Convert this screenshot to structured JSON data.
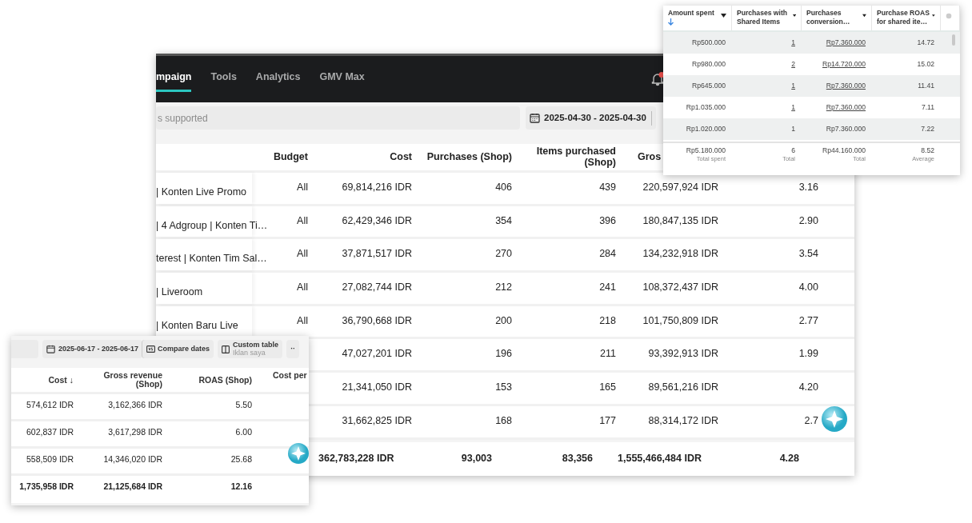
{
  "main_window": {
    "nav": {
      "tabs": [
        {
          "label": "mpaign",
          "selected": true
        },
        {
          "label": "Tools",
          "selected": false
        },
        {
          "label": "Analytics",
          "selected": false
        },
        {
          "label": "GMV Max",
          "selected": false
        }
      ],
      "has_notification": true
    },
    "search": {
      "placeholder": "s supported"
    },
    "date_range": "2025-04-30 - 2025-04-30",
    "table": {
      "headers": {
        "budget": "Budget",
        "cost": "Cost",
        "purchases": "Purchases (Shop)",
        "items": "Items purchased (Shop)",
        "gross": "Gros"
      },
      "rows": [
        {
          "name": "| Konten Live Promo",
          "budget": "All",
          "cost": "69,814,216 IDR",
          "purchases": "406",
          "items": "439",
          "gross": "220,597,924 IDR",
          "roas": "3.16"
        },
        {
          "name": "| 4 Adgroup | Konten Ti…",
          "budget": "All",
          "cost": "62,429,346 IDR",
          "purchases": "354",
          "items": "396",
          "gross": "180,847,135 IDR",
          "roas": "2.90"
        },
        {
          "name": "terest | Konten Tim Sal…",
          "budget": "All",
          "cost": "37,871,517 IDR",
          "purchases": "270",
          "items": "284",
          "gross": "134,232,918 IDR",
          "roas": "3.54"
        },
        {
          "name": "| Liveroom",
          "budget": "All",
          "cost": "27,082,744 IDR",
          "purchases": "212",
          "items": "241",
          "gross": "108,372,437 IDR",
          "roas": "4.00"
        },
        {
          "name": "| Konten Baru Live",
          "budget": "All",
          "cost": "36,790,668 IDR",
          "purchases": "200",
          "items": "218",
          "gross": "101,750,809 IDR",
          "roas": "2.77"
        },
        {
          "cost": "47,027,201 IDR",
          "purchases": "196",
          "items": "211",
          "gross": "93,392,913 IDR",
          "roas": "1.99"
        },
        {
          "cost": "21,341,050 IDR",
          "purchases": "153",
          "items": "165",
          "gross": "89,561,216 IDR",
          "roas": "4.20"
        },
        {
          "cost": "31,662,825 IDR",
          "purchases": "168",
          "items": "177",
          "gross": "88,314,172 IDR",
          "roas": "2.7"
        }
      ],
      "totals": {
        "cost": "362,783,228 IDR",
        "purchases": "93,003",
        "items": "83,356",
        "gross": "1,555,466,484 IDR",
        "roas": "4.28"
      }
    }
  },
  "shared_items_panel": {
    "columns": [
      {
        "label": "Amount spent",
        "sorted": true
      },
      {
        "label": "Purchases with Shared Items",
        "sorted": false
      },
      {
        "label": "Purchases conversion…",
        "sorted": false
      },
      {
        "label": "Purchase ROAS for shared ite…",
        "sorted": false
      }
    ],
    "rows": [
      {
        "cells": [
          "Rp500.000",
          "1",
          "Rp7.360.000",
          "14.72"
        ],
        "linked": true
      },
      {
        "cells": [
          "Rp980.000",
          "2",
          "Rp14.720.000",
          "15.02"
        ],
        "linked": true
      },
      {
        "cells": [
          "Rp645.000",
          "1",
          "Rp7.360.000",
          "11.41"
        ],
        "linked": true
      },
      {
        "cells": [
          "Rp1.035.000",
          "1",
          "Rp7.360.000",
          "7.11"
        ],
        "linked": true
      },
      {
        "cells": [
          "Rp1.020.000",
          "1",
          "Rp7.360.000",
          "7.22"
        ],
        "linked": false
      }
    ],
    "totals": [
      {
        "value": "Rp5.180.000",
        "caption": "Total spent"
      },
      {
        "value": "6",
        "caption": "Total"
      },
      {
        "value": "Rp44.160.000",
        "caption": "Total"
      },
      {
        "value": "8.52",
        "caption": "Average"
      }
    ]
  },
  "shop_panel": {
    "toolbar": {
      "date_range": "2025-06-17 - 2025-06-17",
      "compare_label": "Compare dates",
      "custom_table": {
        "title": "Custom table",
        "subtitle": "Iklan saya"
      },
      "more_label": "··"
    },
    "columns": [
      "Cost ↓",
      "Gross revenue (Shop)",
      "ROAS (Shop)",
      "Cost per"
    ],
    "rows": [
      {
        "cells": [
          "574,612 IDR",
          "3,162,366 IDR",
          "5.50"
        ],
        "total": false
      },
      {
        "cells": [
          "602,837 IDR",
          "3,617,298 IDR",
          "6.00"
        ],
        "total": false
      },
      {
        "cells": [
          "558,509 IDR",
          "14,346,020 IDR",
          "25.68"
        ],
        "total": false
      },
      {
        "cells": [
          "1,735,958 IDR",
          "21,125,684 IDR",
          "12.16"
        ],
        "total": true
      }
    ]
  }
}
